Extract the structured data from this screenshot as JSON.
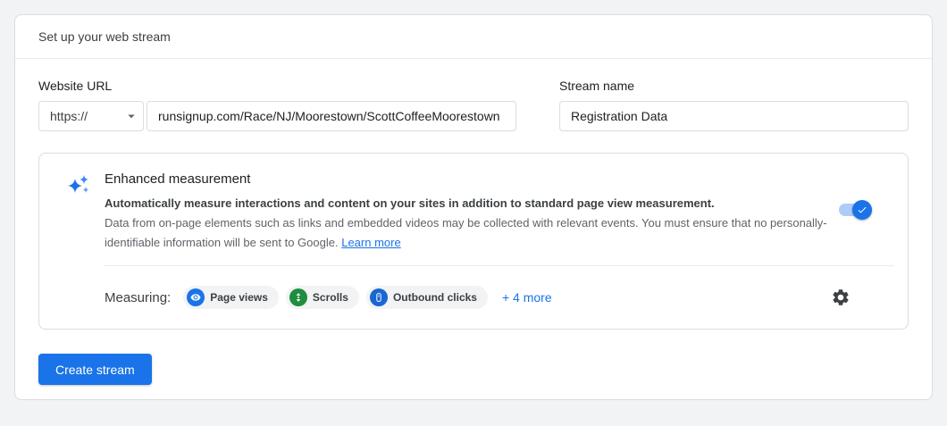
{
  "header": {
    "title": "Set up your web stream"
  },
  "form": {
    "website_url": {
      "label": "Website URL",
      "protocol_value": "https://",
      "url_value": "runsignup.com/Race/NJ/Moorestown/ScottCoffeeMoorestown"
    },
    "stream_name": {
      "label": "Stream name",
      "value": "Registration Data"
    }
  },
  "enhanced_measurement": {
    "title": "Enhanced measurement",
    "description_bold": "Automatically measure interactions and content on your sites in addition to standard page view measurement.",
    "description_rest": "Data from on-page elements such as links and embedded videos may be collected with relevant events. You must ensure that no personally-identifiable information will be sent to Google.",
    "learn_more_label": "Learn more",
    "toggle_state": "on",
    "measuring": {
      "label": "Measuring:",
      "chips": [
        {
          "label": "Page views",
          "icon": "eye-icon",
          "color": "#1a73e8"
        },
        {
          "label": "Scrolls",
          "icon": "scroll-arrows-icon",
          "color": "#1e8e3e"
        },
        {
          "label": "Outbound clicks",
          "icon": "mouse-icon",
          "color": "#1967d2"
        }
      ],
      "more_label": "+ 4 more"
    }
  },
  "actions": {
    "create_stream_label": "Create stream"
  },
  "colors": {
    "accent_blue": "#1a73e8",
    "link_blue": "#1a73e8",
    "toggle_track": "#aecbfa",
    "toggle_thumb": "#1a73e8",
    "chip_background": "#f1f3f4",
    "card_border": "#dadce0"
  }
}
